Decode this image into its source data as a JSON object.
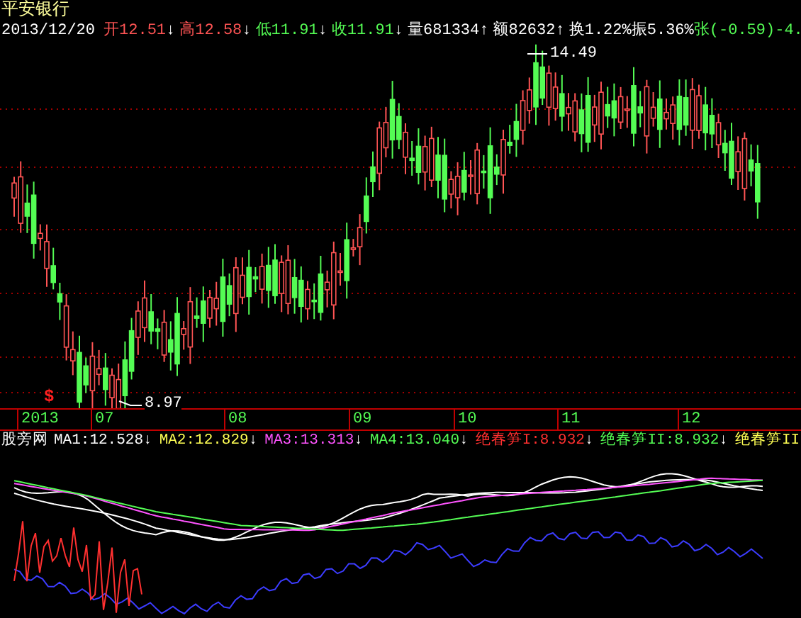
{
  "stock": {
    "name": "平安银行"
  },
  "quote": {
    "date": "2013/12/20",
    "fields": [
      {
        "text": "开12.51",
        "arrow": "↓",
        "color": "#ff5454"
      },
      {
        "text": "高12.58",
        "arrow": "↓",
        "color": "#ff5454"
      },
      {
        "text": "低11.91",
        "arrow": "↓",
        "color": "#54fc54"
      },
      {
        "text": "收11.91",
        "arrow": "↓",
        "color": "#54fc54"
      },
      {
        "text": "量681334",
        "arrow": "↑",
        "color": "#ffffff"
      },
      {
        "text": "额82632",
        "arrow": "↑",
        "color": "#ffffff"
      },
      {
        "text": "换1.22%",
        "color": "#ffffff"
      },
      {
        "text": "振5.36%",
        "color": "#ffffff"
      },
      {
        "text": "张(-0.59)-4.",
        "color": "#54fc54"
      }
    ]
  },
  "price_marks": {
    "high": "14.49",
    "low": "8.97"
  },
  "signal_mark": "$",
  "x_axis": {
    "labels": [
      "2013",
      "07",
      "08",
      "09",
      "10",
      "11",
      "12"
    ]
  },
  "indicator": {
    "name": "股旁网",
    "lines": [
      {
        "text": "MA1:12.528",
        "arrow": "↓",
        "color": "#ffffff"
      },
      {
        "text": "MA2:12.829",
        "arrow": "↓",
        "color": "#ffff54"
      },
      {
        "text": "MA3:13.313",
        "arrow": "↓",
        "color": "#ff54ff"
      },
      {
        "text": "MA4:13.040",
        "arrow": "↓",
        "color": "#54fc54"
      },
      {
        "text": "绝春笋I:8.932",
        "arrow": "↓",
        "color": "#ff3030"
      },
      {
        "text": "绝春笋II:8.932",
        "arrow": "↓",
        "color": "#54fc54"
      },
      {
        "text": "绝春笋II",
        "color": "#ffff54"
      }
    ]
  }
}
